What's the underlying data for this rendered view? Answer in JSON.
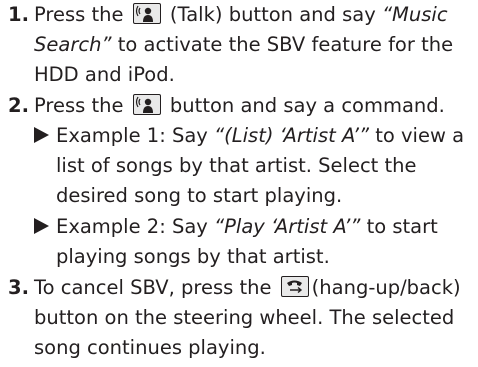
{
  "steps": [
    {
      "number": "1.",
      "lines": [
        [
          "Press the ",
          "ICON:talk",
          " (Talk) button and say ",
          "“Music"
        ],
        [
          "Search”",
          " to activate the SBV feature for the"
        ],
        [
          "HDD and iPod."
        ]
      ]
    },
    {
      "number": "2.",
      "lines": [
        [
          "Press the ",
          "ICON:talk",
          " button and say a command."
        ]
      ],
      "examples": [
        {
          "lines": [
            [
              "Example 1: Say ",
              "“(List) ‘Artist A’”",
              " to view a"
            ],
            [
              "list of songs by that artist. Select the"
            ],
            [
              "desired song to start playing."
            ]
          ]
        },
        {
          "lines": [
            [
              "Example 2: Say ",
              "“Play ‘Artist A’”",
              " to start"
            ],
            [
              "playing songs by that artist."
            ]
          ]
        }
      ]
    },
    {
      "number": "3.",
      "lines": [
        [
          "To cancel SBV, press the ",
          "ICON:hangup",
          "(hang-up/back)"
        ],
        [
          "button on the steering wheel. The selected"
        ],
        [
          "song continues playing."
        ]
      ]
    }
  ],
  "text": {
    "s1_a": "Press the ",
    "s1_b": " (Talk) button and say ",
    "s1_c": "“Music",
    "s1_d": "Search”",
    "s1_e": " to activate the SBV feature for the",
    "s1_f": "HDD and iPod.",
    "s2_a": "Press the ",
    "s2_b": " button and say a command.",
    "e1_a": "Example 1: Say ",
    "e1_b": "“(List) ‘Artist A’”",
    "e1_c": " to view a",
    "e1_d": "list of songs by that artist. Select the",
    "e1_e": "desired song to start playing.",
    "e2_a": "Example 2: Say ",
    "e2_b": "“Play ‘Artist A’”",
    "e2_c": " to start",
    "e2_d": "playing songs by that artist.",
    "s3_a": "To cancel SBV, press the ",
    "s3_b": "(hang-up/back)",
    "s3_c": "button on the steering wheel. The selected",
    "s3_d": "song continues playing.",
    "n1": "1.",
    "n2": "2.",
    "n3": "3."
  },
  "icons": {
    "talk": "talk-button-icon",
    "hangup": "hang-up-back-button-icon",
    "example_marker": "triangle-bullet-icon"
  }
}
